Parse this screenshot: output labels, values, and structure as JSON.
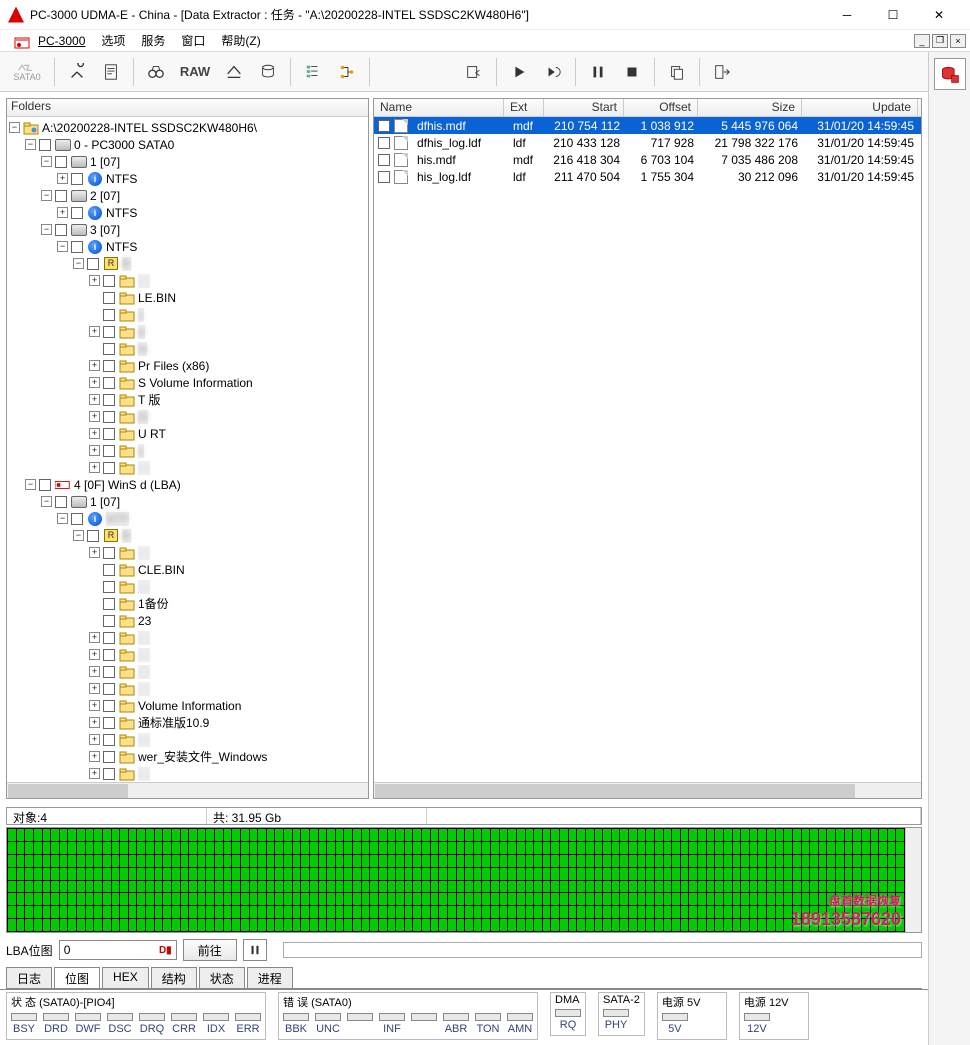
{
  "window": {
    "title": "PC-3000 UDMA-E - China - [Data Extractor : 任务 - \"A:\\20200228-INTEL SSDSC2KW480H6\"]"
  },
  "menu": {
    "app": "PC-3000",
    "items": [
      "选项",
      "服务",
      "窗口",
      "帮助(Z)"
    ]
  },
  "toolbar": {
    "sata": "SATA0",
    "raw": "RAW"
  },
  "tree": {
    "header": "Folders",
    "root": "A:\\20200228-INTEL SSDSC2KW480H6\\",
    "n0": "0 - PC3000 SATA0",
    "p1": "1 [07]",
    "p2": "2 [07]",
    "p3": "3 [07]",
    "ntfs": "NTFS",
    "r": "R",
    "r_txt": "R",
    "le_bin": "LE.BIN",
    "c": "c",
    "d": "d",
    "hi": "hi",
    "pf": "Pr      Files (x86)",
    "svi": "S     Volume Information",
    "tban": "T    版",
    "t3": "t3",
    "urt": "U     RT",
    "z": "z",
    "n4": "4 [0F] WinS          d  (LBA)",
    "p1b": "1 [07]",
    "ntfb": "NTF",
    "cle": "CLE.BIN",
    "bf": "1备份",
    "t23": "23",
    "svi2": "Volume Information",
    "tj": "通标准版10.9",
    "wer": "wer_安装文件_Windows"
  },
  "filelist": {
    "columns": {
      "name": "Name",
      "ext": "Ext",
      "start": "Start",
      "offset": "Offset",
      "size": "Size",
      "update": "Update"
    },
    "rows": [
      {
        "name": "dfhis.mdf",
        "ext": "mdf",
        "start": "210 754 112",
        "offset": "1 038 912",
        "size": "5 445 976 064",
        "update": "31/01/20 14:59:45",
        "selected": true
      },
      {
        "name": "dfhis_log.ldf",
        "ext": "ldf",
        "start": "210 433 128",
        "offset": "717 928",
        "size": "21 798 322 176",
        "update": "31/01/20 14:59:45"
      },
      {
        "name": "his.mdf",
        "ext": "mdf",
        "start": "216 418 304",
        "offset": "6 703 104",
        "size": "7 035 486 208",
        "update": "31/01/20 14:59:45"
      },
      {
        "name": "his_log.ldf",
        "ext": "ldf",
        "start": "211 470 504",
        "offset": "1 755 304",
        "size": "30 212 096",
        "update": "31/01/20 14:59:45"
      }
    ]
  },
  "stats": {
    "objects": "对象:4",
    "total": "共:  31.95 Gb"
  },
  "nav": {
    "lba_label": "LBA位图",
    "lba_value": "0",
    "go": "前往"
  },
  "tabs": [
    "日志",
    "位图",
    "HEX",
    "结构",
    "状态",
    "进程"
  ],
  "status": {
    "state_label": "状 态 (SATA0)-[PIO4]",
    "state": [
      "BSY",
      "DRD",
      "DWF",
      "DSC",
      "DRQ",
      "CRR",
      "IDX",
      "ERR"
    ],
    "err_label": "错 误 (SATA0)",
    "err": [
      "BBK",
      "UNC",
      "",
      "INF",
      "",
      "ABR",
      "TON",
      "AMN"
    ],
    "dma_label": "DMA",
    "dma": [
      "RQ"
    ],
    "sata2_label": "SATA-2",
    "sata2": [
      "PHY"
    ],
    "p5_label": "电源 5V",
    "p5": [
      "5V"
    ],
    "p12_label": "电源 12V",
    "p12": [
      "12V"
    ]
  },
  "watermark": {
    "l1": "盘首数据恢复",
    "l2": "18913587620"
  }
}
